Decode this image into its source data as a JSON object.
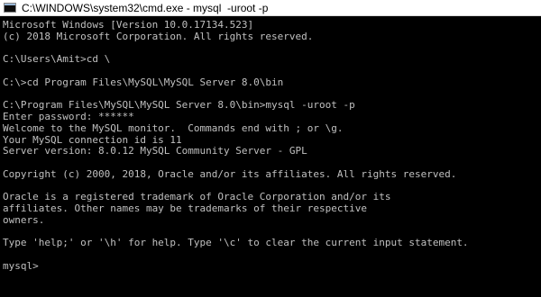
{
  "window": {
    "title": "C:\\WINDOWS\\system32\\cmd.exe - mysql  -uroot -p",
    "icon": "cmd-icon"
  },
  "console": {
    "text_color": "#c0c0c0",
    "background_color": "#000000",
    "lines": [
      "Microsoft Windows [Version 10.0.17134.523]",
      "(c) 2018 Microsoft Corporation. All rights reserved.",
      "",
      "C:\\Users\\Amit>cd \\",
      "",
      "C:\\>cd Program Files\\MySQL\\MySQL Server 8.0\\bin",
      "",
      "C:\\Program Files\\MySQL\\MySQL Server 8.0\\bin>mysql -uroot -p",
      "Enter password: ******",
      "Welcome to the MySQL monitor.  Commands end with ; or \\g.",
      "Your MySQL connection id is 11",
      "Server version: 8.0.12 MySQL Community Server - GPL",
      "",
      "Copyright (c) 2000, 2018, Oracle and/or its affiliates. All rights reserved.",
      "",
      "Oracle is a registered trademark of Oracle Corporation and/or its",
      "affiliates. Other names may be trademarks of their respective",
      "owners.",
      "",
      "Type 'help;' or '\\h' for help. Type '\\c' to clear the current input statement.",
      "",
      "mysql>"
    ]
  }
}
